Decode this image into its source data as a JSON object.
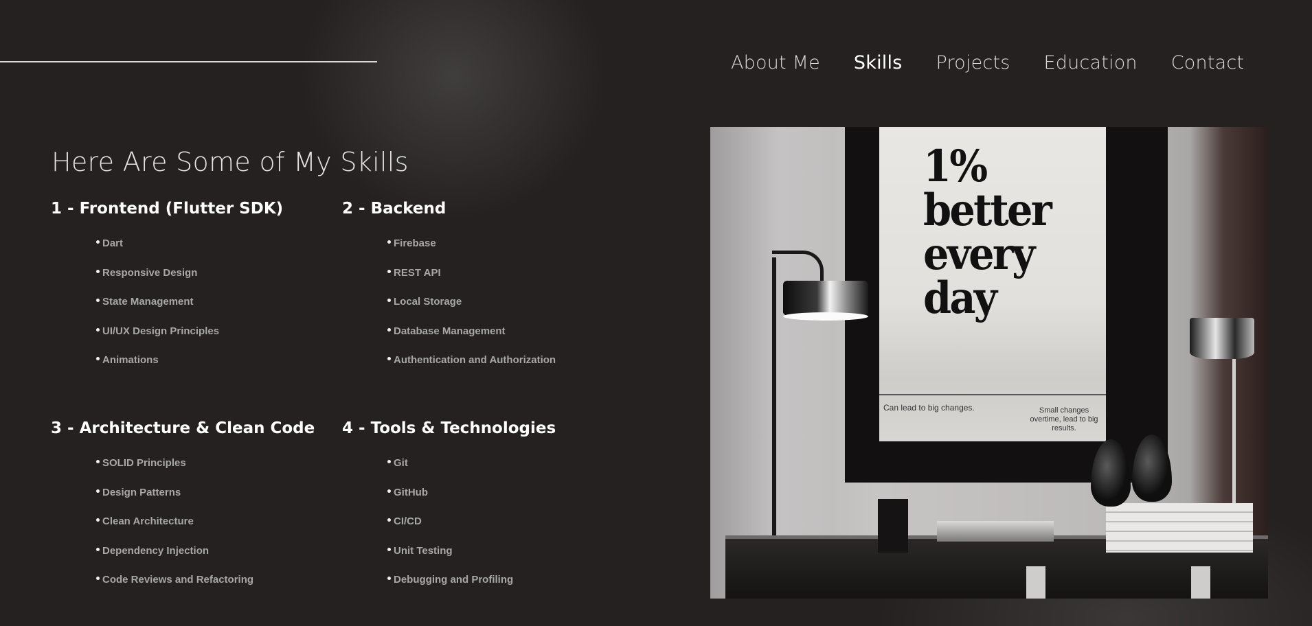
{
  "nav": {
    "items": [
      "About Me",
      "Skills",
      "Projects",
      "Education",
      "Contact"
    ],
    "active": "Skills"
  },
  "page": {
    "title": "Here Are Some of My Skills"
  },
  "skills": [
    {
      "heading": "1 - Frontend (Flutter SDK)",
      "items": [
        "Dart",
        "Responsive Design",
        "State Management",
        "UI/UX Design Principles",
        "Animations"
      ]
    },
    {
      "heading": "2 - Backend",
      "items": [
        "Firebase",
        "REST API",
        "Local Storage",
        "Database Management",
        "Authentication and Authorization"
      ]
    },
    {
      "heading": "3 - Architecture & Clean Code",
      "items": [
        "SOLID Principles",
        "Design Patterns",
        "Clean Architecture",
        "Dependency Injection",
        "Code Reviews and Refactoring"
      ]
    },
    {
      "heading": "4 - Tools & Technologies",
      "items": [
        "Git",
        "GitHub",
        "CI/CD",
        "Unit Testing",
        "Debugging and Profiling"
      ]
    }
  ],
  "image": {
    "poster_lines": [
      "1%",
      "better",
      "every",
      "day"
    ],
    "caption_left": "Can lead to big changes.",
    "caption_right": "Small changes overtime, lead to big results."
  },
  "colors": {
    "background": "#242120",
    "text_primary": "#ffffff",
    "text_muted": "#a8a8a8",
    "rule": "#d9d9d9"
  }
}
